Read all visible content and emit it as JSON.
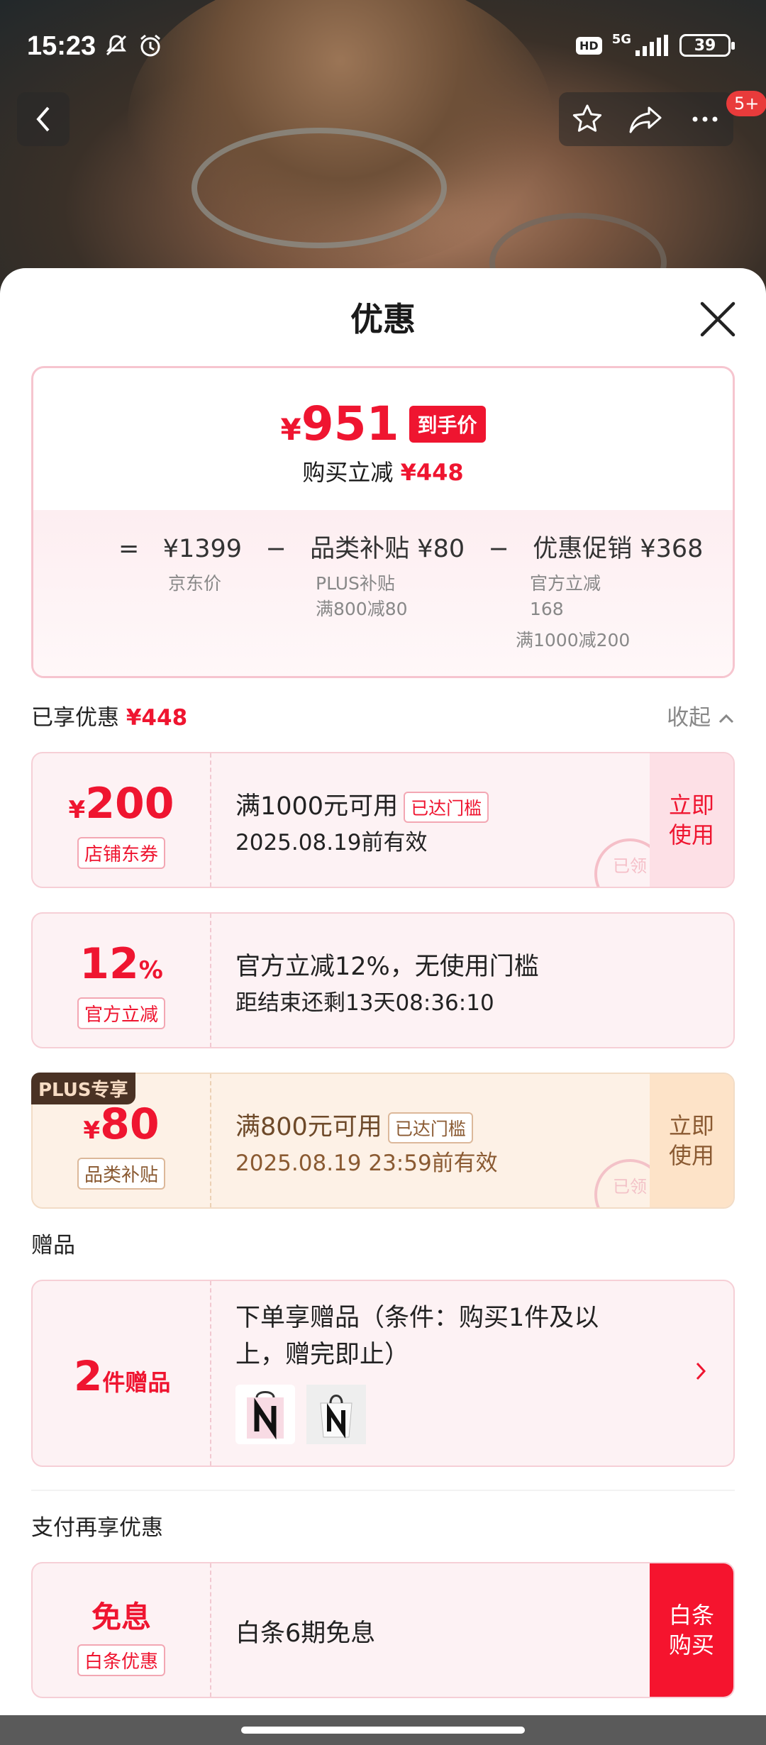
{
  "status_bar": {
    "time": "15:23",
    "hd": "HD",
    "network": "5G",
    "battery": "39"
  },
  "header": {
    "notification_badge": "5+"
  },
  "sheet": {
    "title": "优惠"
  },
  "price_summary": {
    "final_price": "951",
    "currency": "¥",
    "final_tag": "到手价",
    "save_label": "购买立减",
    "save_amount": "¥448",
    "formula": {
      "equals": "=",
      "jd_price": "¥1399",
      "minus1": "−",
      "category_subsidy": "品类补贴 ¥80",
      "minus2": "−",
      "promo": "优惠促销 ¥368"
    },
    "jd_price_label": "京东价",
    "plus_label": "PLUS补贴",
    "plus_detail": "满800减80",
    "official_label": "官方立减",
    "official_amount": "168",
    "full_reduction": "满1000减200"
  },
  "enjoyed": {
    "label": "已享优惠",
    "amount": "¥448",
    "collapse": "收起"
  },
  "coupons": [
    {
      "amount": "200",
      "currency": "¥",
      "kind": "店铺东券",
      "condition": "满1000元可用",
      "reach": "已达门槛",
      "date": "2025.08.19前有效",
      "use": "立即使用",
      "stamp": "已领"
    },
    {
      "amount": "12",
      "pct": "%",
      "kind": "官方立减",
      "condition": "官方立减12%，无使用门槛",
      "date": "距结束还剩13天08:36:10"
    },
    {
      "plus_tag": "PLUS专享",
      "amount": "80",
      "currency": "¥",
      "kind": "品类补贴",
      "condition": "满800元可用",
      "reach": "已达门槛",
      "date": "2025.08.19 23:59前有效",
      "use": "立即使用",
      "stamp": "已领"
    }
  ],
  "gift_section": {
    "label": "赠品",
    "count": "2",
    "unit": "件赠品",
    "description": "下单享赠品（条件：购买1件及以上，赠完即止）"
  },
  "pay_section": {
    "label": "支付再享优惠",
    "big": "免息",
    "kind": "白条优惠",
    "main": "白条6期免息",
    "buy": "白条购买"
  }
}
